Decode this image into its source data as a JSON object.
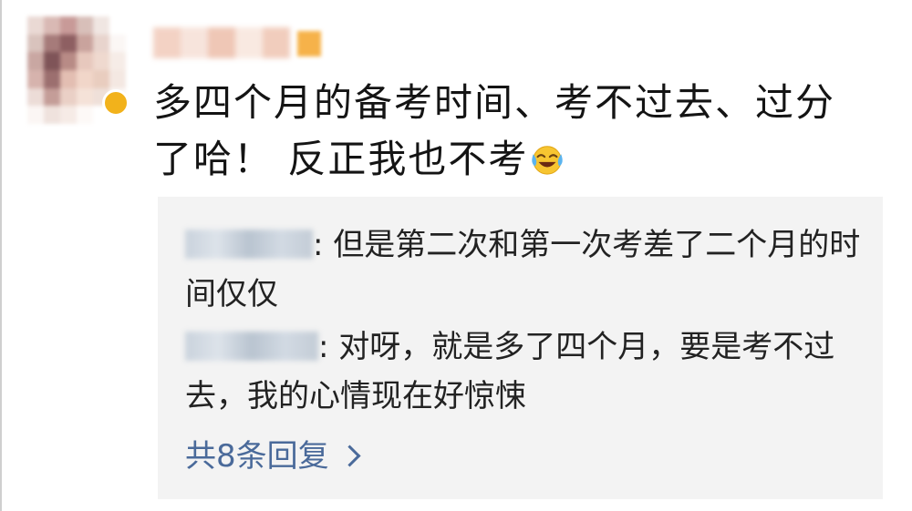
{
  "comment": {
    "author_name": "",
    "text": "多四个月的备考时间、考不过去、过分了哈！ 反正我也不考",
    "emoji": "laugh-cry-emoji"
  },
  "replies": [
    {
      "author_name": "",
      "text": ": 但是第二次和第一次考差了二个月的时间仅仅"
    },
    {
      "author_name": "",
      "text": ": 对呀，就是多了四个月，要是考不过去，我的心情现在好惊悚"
    }
  ],
  "more_replies_label": "共8条回复",
  "colors": {
    "link": "#4a6a9a",
    "panel_background": "#f3f3f3",
    "badge": "#f2b21b"
  }
}
